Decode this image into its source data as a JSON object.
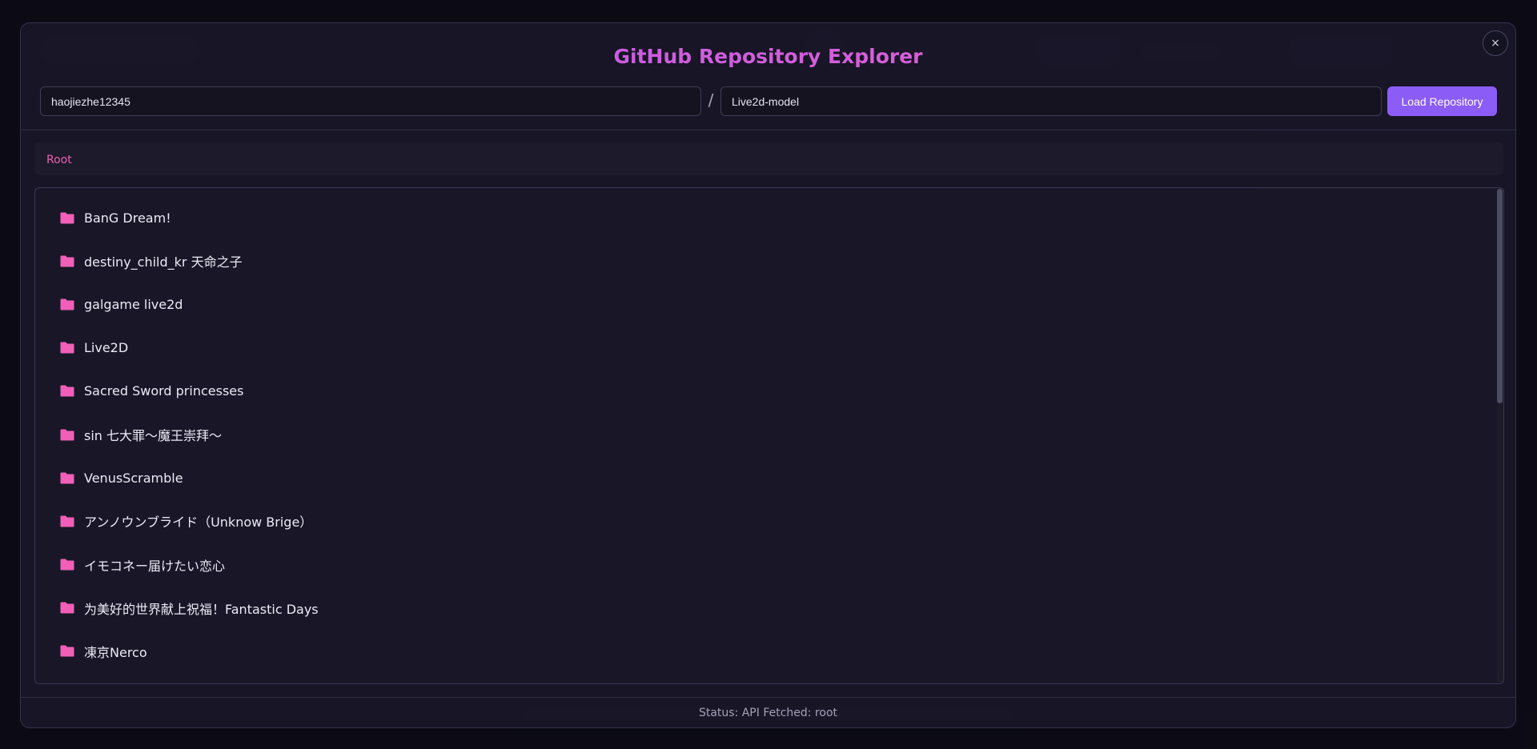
{
  "modal": {
    "title": "GitHub Repository Explorer",
    "close_label": "×",
    "owner_value": "haojiezhe12345",
    "repo_value": "Live2d-model",
    "separator": "/",
    "load_button_label": "Load Repository"
  },
  "breadcrumb": {
    "items": [
      {
        "label": "Root"
      }
    ]
  },
  "file_list": {
    "icon": "folder-icon",
    "items": [
      {
        "name": "BanG Dream!",
        "type": "folder"
      },
      {
        "name": "destiny_child_kr 天命之子",
        "type": "folder"
      },
      {
        "name": "galgame live2d",
        "type": "folder"
      },
      {
        "name": "Live2D",
        "type": "folder"
      },
      {
        "name": "Sacred Sword princesses",
        "type": "folder"
      },
      {
        "name": "sin 七大罪～魔王崇拜～",
        "type": "folder"
      },
      {
        "name": "VenusScramble",
        "type": "folder"
      },
      {
        "name": "アンノウンブライド（Unknow Brige）",
        "type": "folder"
      },
      {
        "name": "イモコネー届けたい恋心",
        "type": "folder"
      },
      {
        "name": "为美好的世界献上祝福！Fantastic Days",
        "type": "folder"
      },
      {
        "name": "凍京Nerco",
        "type": "folder"
      }
    ]
  },
  "status": {
    "text": "Status: API Fetched: root"
  },
  "colors": {
    "accent": "#8b5cf6",
    "folder": "#f15fb8",
    "crumb": "#ec5fb3",
    "title_gradient_start": "#b45cf2",
    "title_gradient_end": "#ee5fc6"
  }
}
